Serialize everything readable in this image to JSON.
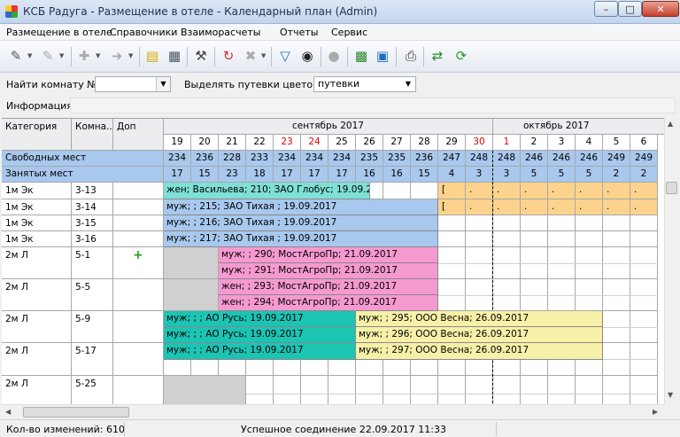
{
  "window": {
    "title": "КСБ Радуга - Размещение в отеле - Календарный план (Admin)"
  },
  "menu": [
    "Размещение в отеле",
    "Справочники",
    "Взаиморасчеты",
    "Отчеты",
    "Сервис"
  ],
  "toolbar_icons": [
    "new-booking-icon",
    "edit-icon",
    "add-guest-icon",
    "checkout-icon",
    "document-icon",
    "report-icon",
    "tools-icon",
    "refresh-cycle-icon",
    "clear-filter-icon",
    "filter-icon",
    "find-icon",
    "lightbulb-icon",
    "room-plan-icon",
    "preview-icon",
    "print-icon",
    "export-icon",
    "reload-icon"
  ],
  "filter": {
    "find_room_label": "Найти комнату №:",
    "find_room_value": "",
    "highlight_label": "Выделять путевки цветом:",
    "highlight_value": "путевки",
    "info_label": "Информация:",
    "info_value": ""
  },
  "grid": {
    "headers": {
      "category": "Категория",
      "room": "Комна...",
      "extra": "Доп"
    },
    "months": [
      {
        "name": "сентябрь 2017"
      },
      {
        "name": "октябрь 2017"
      }
    ],
    "days": [
      "19",
      "20",
      "21",
      "22",
      "23",
      "24",
      "25",
      "26",
      "27",
      "28",
      "29",
      "30",
      "1",
      "2",
      "3",
      "4",
      "5",
      "6"
    ],
    "weekend_days": [
      4,
      5,
      11,
      12
    ],
    "summary": [
      {
        "label": "Свободных мест",
        "values": [
          "234",
          "236",
          "228",
          "233",
          "234",
          "234",
          "234",
          "235",
          "235",
          "236",
          "247",
          "248",
          "248",
          "246",
          "246",
          "246",
          "249",
          "249"
        ]
      },
      {
        "label": "Занятых мест",
        "values": [
          "17",
          "15",
          "23",
          "18",
          "17",
          "17",
          "17",
          "16",
          "16",
          "15",
          "4",
          "3",
          "3",
          "5",
          "5",
          "5",
          "2",
          "2"
        ]
      }
    ],
    "rooms": [
      {
        "category": "1м Эк",
        "room": "3-13",
        "extra": ""
      },
      {
        "category": "1м Эк",
        "room": "3-14",
        "extra": ""
      },
      {
        "category": "1м Эк",
        "room": "3-15",
        "extra": ""
      },
      {
        "category": "1м Эк",
        "room": "3-16",
        "extra": ""
      },
      {
        "category": "2м Л",
        "room": "5-1",
        "extra": "+"
      },
      {
        "category": "2м Л",
        "room": "5-5",
        "extra": ""
      },
      {
        "category": "2м Л",
        "room": "5-9",
        "extra": ""
      },
      {
        "category": "2м Л",
        "room": "5-17",
        "extra": ""
      },
      {
        "category": "2м Л",
        "room": "5-25",
        "extra": ""
      }
    ],
    "bookings": [
      {
        "text": "жен; Васильева; 210; ЗАО Глобус; 19.09.2",
        "color": "#7fe0d6"
      },
      {
        "text": "муж; ; 215; ЗАО Тихая ; 19.09.2017",
        "color": "#a8c8ee"
      },
      {
        "text": "муж; ; 216; ЗАО Тихая ; 19.09.2017",
        "color": "#a8c8ee"
      },
      {
        "text": "муж; ; 217; ЗАО Тихая ; 19.09.2017",
        "color": "#a8c8ee"
      },
      {
        "text": "муж; ; 290; МостАгроПр; 21.09.2017",
        "color": "#f59ad0"
      },
      {
        "text": "муж; ; 291; МостАгроПр; 21.09.2017",
        "color": "#f59ad0"
      },
      {
        "text": "жен; ; 293; МостАгроПр; 21.09.2017",
        "color": "#f59ad0"
      },
      {
        "text": "жен; ; 294; МостАгроПр; 21.09.2017",
        "color": "#f59ad0"
      },
      {
        "text": "муж; ; ; АО Русь; 19.09.2017",
        "color": "#1cc4b4"
      },
      {
        "text": "муж; ; 295; ООО Весна; 26.09.2017",
        "color": "#f7f0a8"
      },
      {
        "text": "муж; ; ; АО Русь; 19.09.2017",
        "color": "#1cc4b4"
      },
      {
        "text": "муж; ; 296; ООО Весна; 26.09.2017",
        "color": "#f7f0a8"
      },
      {
        "text": "муж; ; ; АО Русь; 19.09.2017",
        "color": "#1cc4b4"
      },
      {
        "text": "муж; ; 297; ООО Весна; 26.09.2017",
        "color": "#f7f0a8"
      }
    ],
    "future_marks": [
      "[",
      ".",
      ".",
      ".",
      ".",
      ".",
      ".",
      ".",
      "[",
      ".",
      ".",
      ".",
      ".",
      ".",
      ".",
      "."
    ]
  },
  "status": {
    "changes": "Кол-во изменений: 610",
    "connection": "Успешное соединение 22.09.2017 11:33"
  },
  "colors": {
    "summary_bg": "#a8c8ee",
    "future_bg": "#fcd38d",
    "weekend": "#e00000",
    "gray": "#d0d0d0"
  }
}
